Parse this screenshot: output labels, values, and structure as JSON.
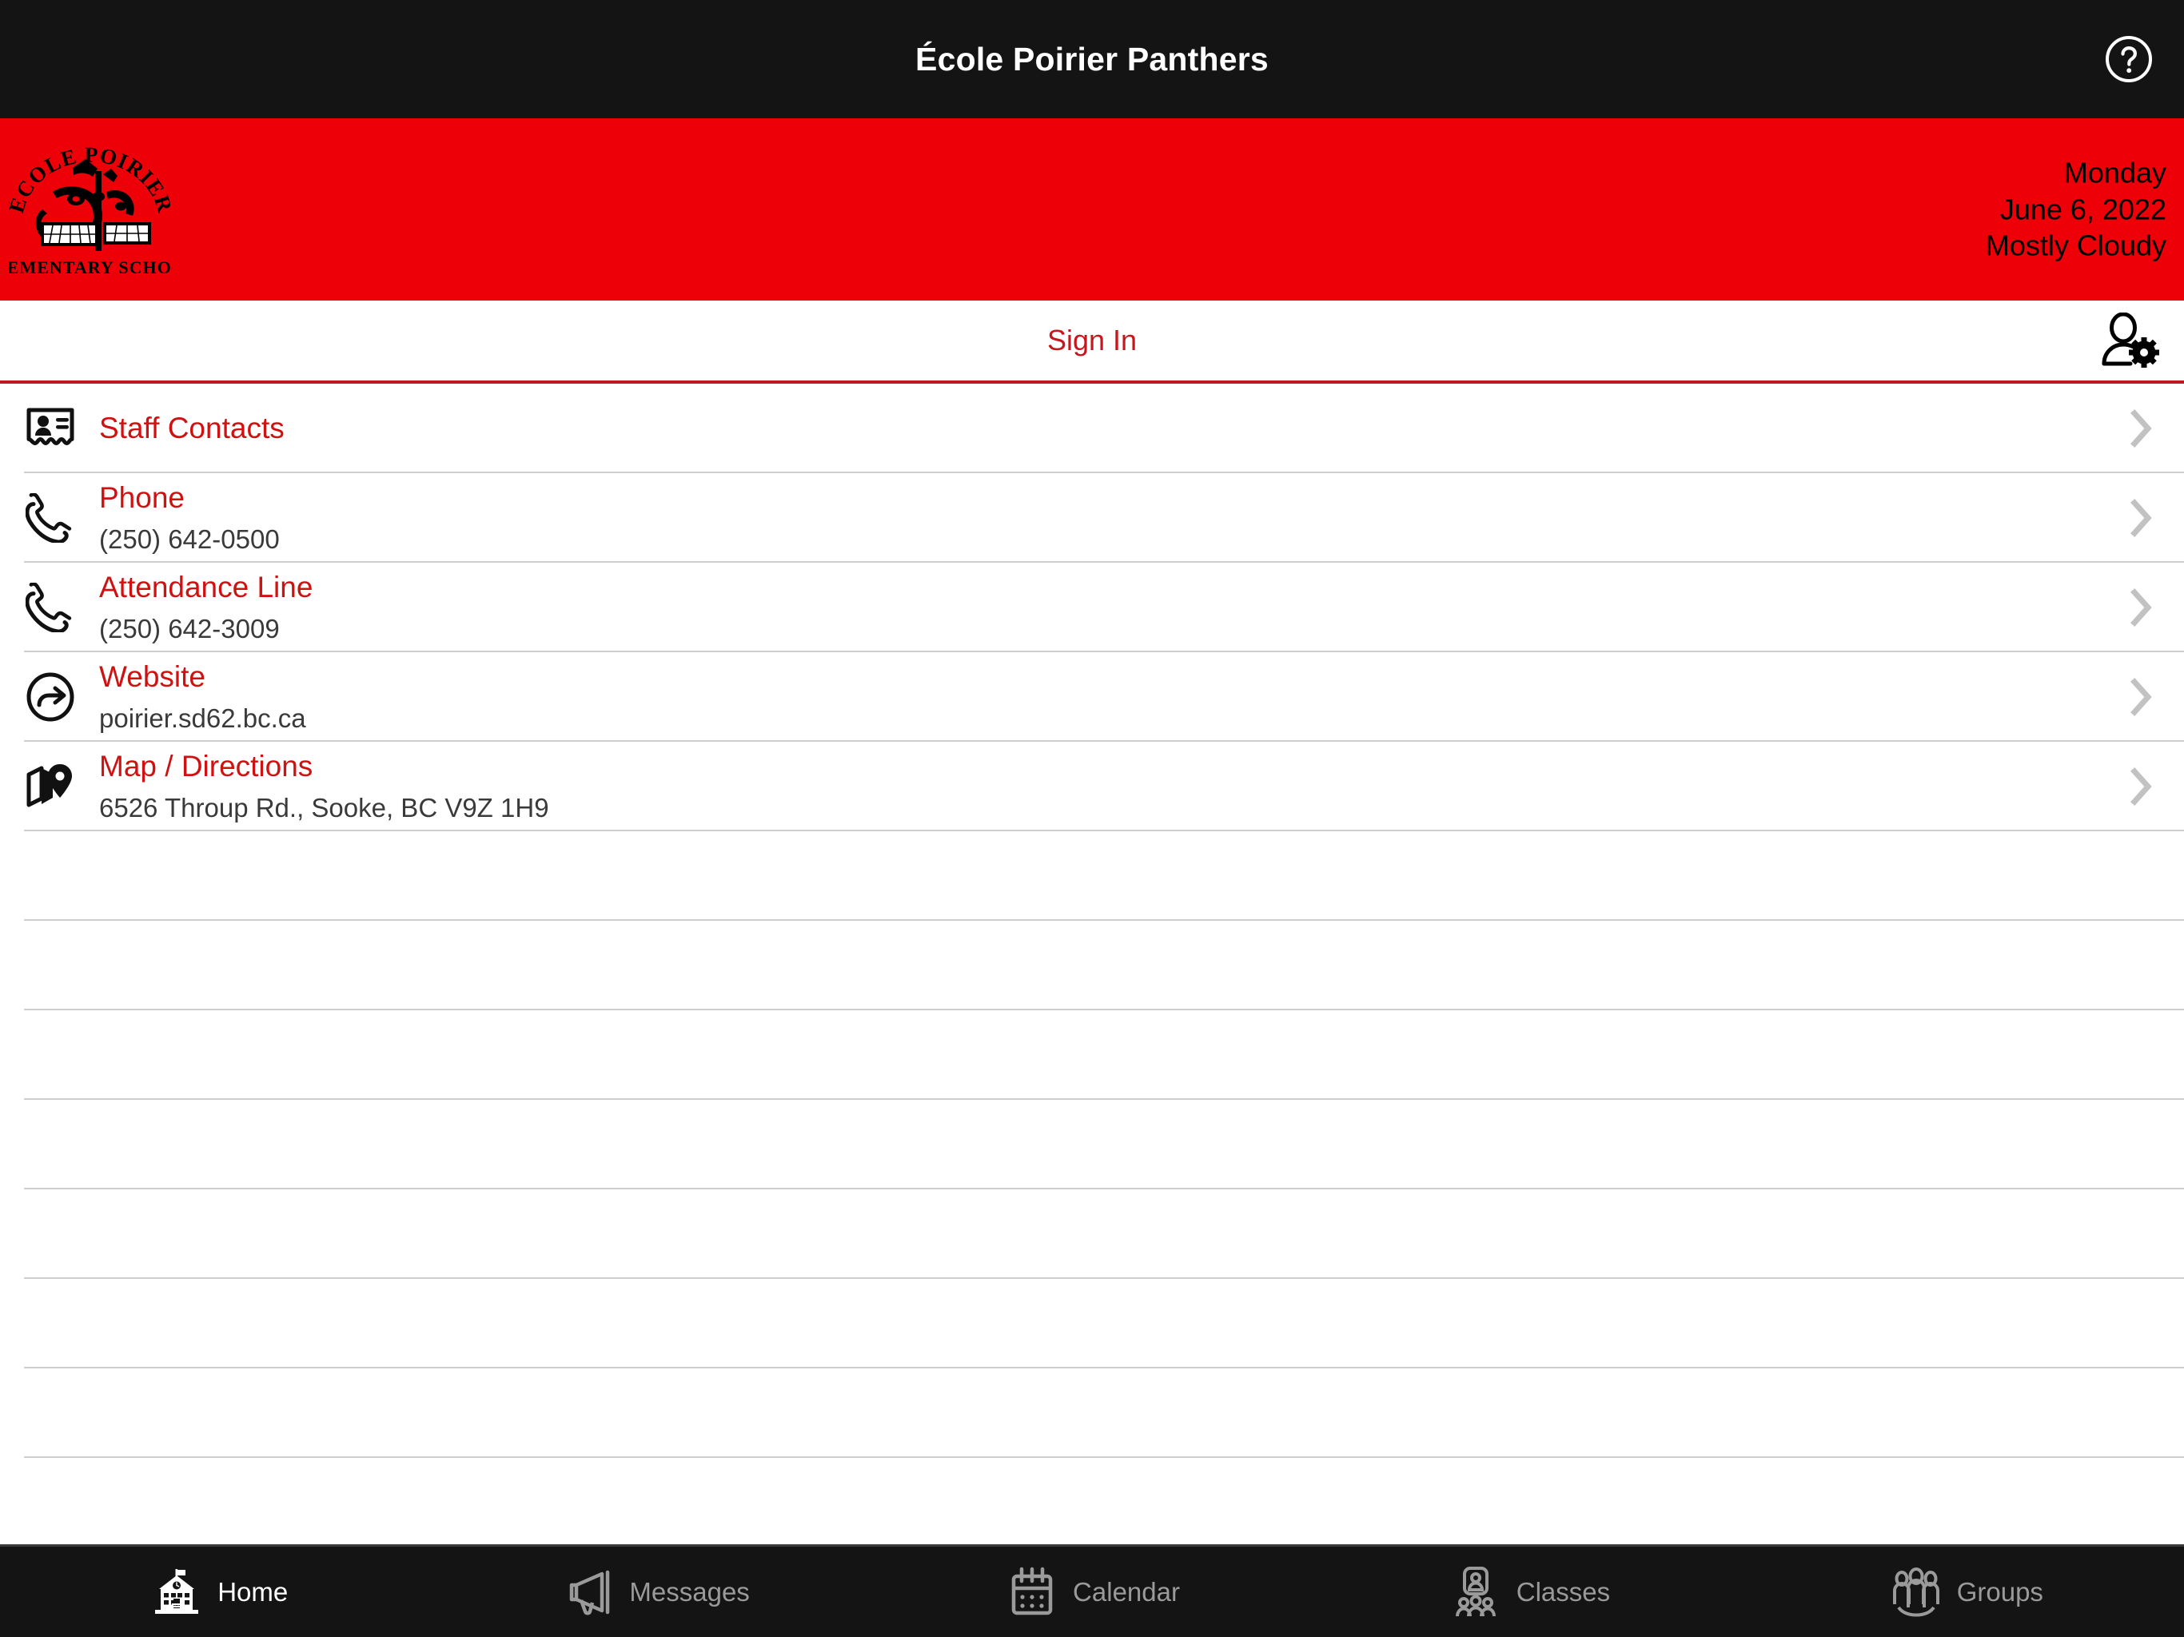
{
  "header": {
    "title": "École Poirier Panthers",
    "help_icon": "help-circle-icon"
  },
  "banner": {
    "logo_arc_top": "ÉCOLE POIRIER",
    "logo_arc_bottom": "ELEMENTARY SCHOOL",
    "day": "Monday",
    "date": "June 6, 2022",
    "weather": "Mostly Cloudy",
    "background_color": "#ED0008"
  },
  "account_bar": {
    "sign_in_label": "Sign In",
    "settings_icon": "user-settings-icon",
    "accent_color": "#C8161D"
  },
  "list": {
    "items": [
      {
        "icon": "contact-card-icon",
        "title": "Staff Contacts",
        "subtitle": ""
      },
      {
        "icon": "phone-icon",
        "title": "Phone",
        "subtitle": "(250) 642-0500"
      },
      {
        "icon": "phone-icon",
        "title": "Attendance Line",
        "subtitle": "(250) 642-3009"
      },
      {
        "icon": "external-link-icon",
        "title": "Website",
        "subtitle": "poirier.sd62.bc.ca"
      },
      {
        "icon": "map-pin-icon",
        "title": "Map / Directions",
        "subtitle": "6526 Throup Rd., Sooke, BC V9Z 1H9"
      }
    ],
    "empty_row_count": 7,
    "title_color": "#CF1111",
    "chevron_icon": "chevron-right-icon"
  },
  "tabbar": {
    "tabs": [
      {
        "label": "Home",
        "icon": "school-house-icon",
        "active": true
      },
      {
        "label": "Messages",
        "icon": "megaphone-icon",
        "active": false
      },
      {
        "label": "Calendar",
        "icon": "calendar-icon",
        "active": false
      },
      {
        "label": "Classes",
        "icon": "classes-icon",
        "active": false
      },
      {
        "label": "Groups",
        "icon": "groups-icon",
        "active": false
      }
    ]
  }
}
